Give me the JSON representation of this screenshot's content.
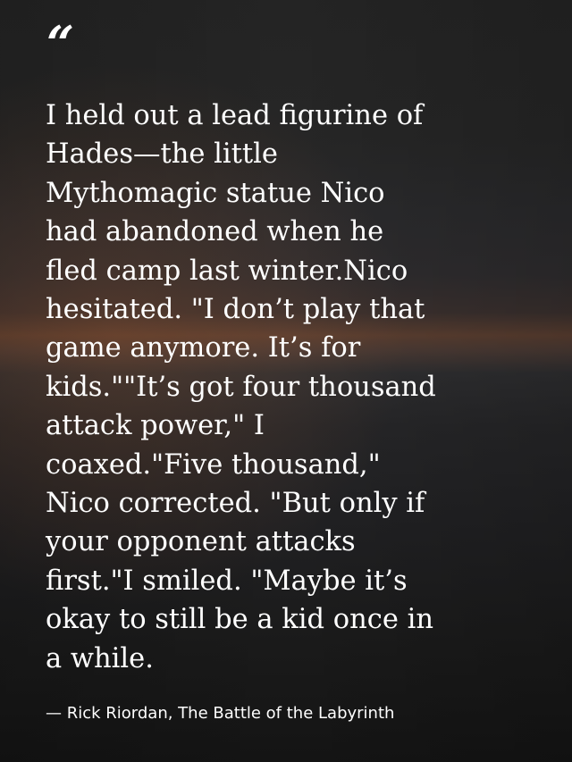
{
  "quote": {
    "mark": "“",
    "lines": [
      "I held out a lead figurine of",
      "Hades—the little",
      "Mythomagic statue Nico",
      "had abandoned when he",
      "fled camp last winter.Nico",
      "hesitated. \"I don’t play that",
      "game anymore. It’s for",
      "kids.\"\"It’s got four thousand",
      "attack power,\" I",
      "coaxed.\"Five thousand,\"",
      "Nico corrected. \"But only if",
      "your opponent attacks",
      "first.\"I smiled. \"Maybe it’s",
      "okay to still be a kid once in",
      "a while."
    ]
  },
  "attribution": "— Rick Riordan, The Battle of the Labyrinth",
  "colors": {
    "text": "#ffffff",
    "sunset_glow": "#5a3e30",
    "sky_dark": "#242424"
  }
}
